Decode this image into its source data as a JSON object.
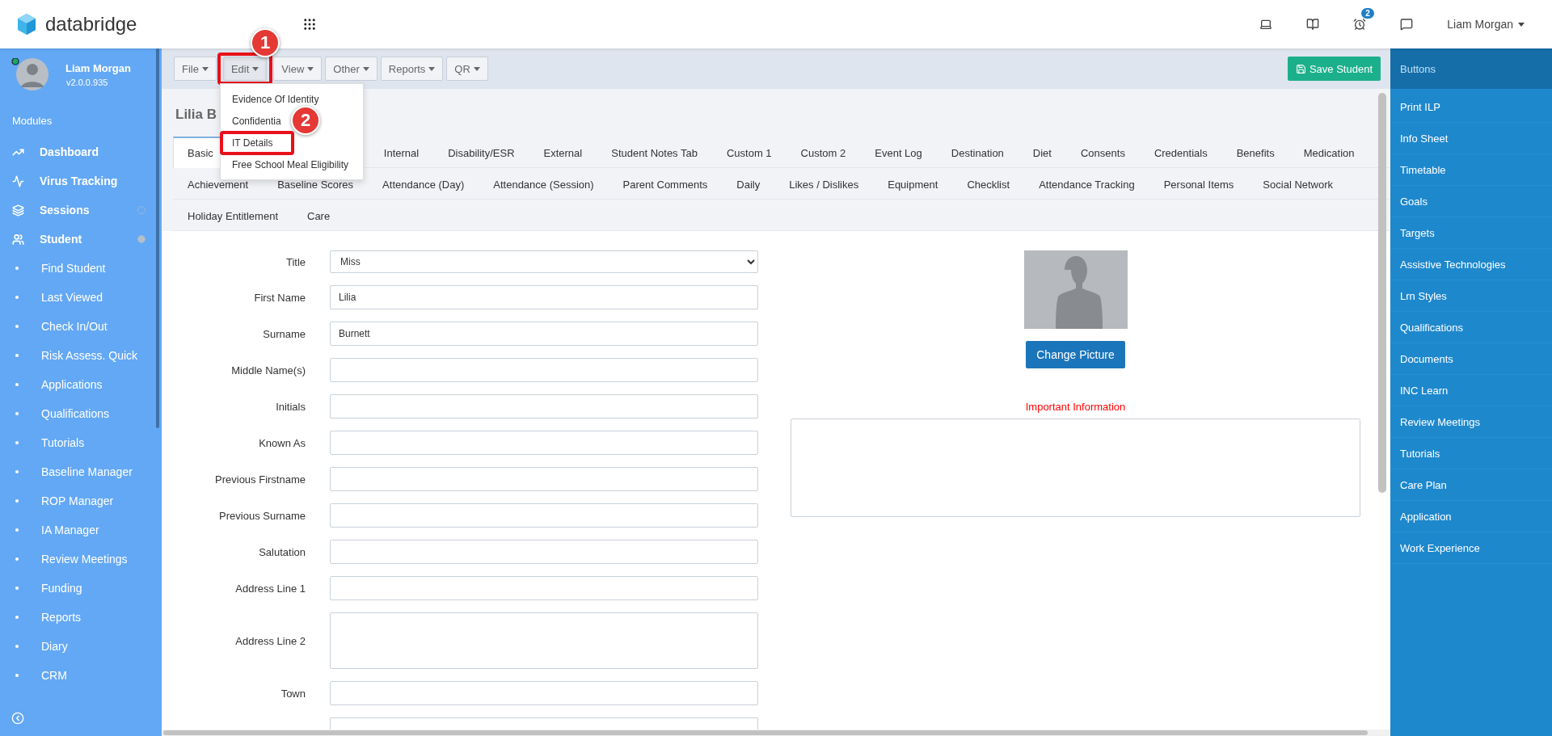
{
  "header": {
    "brand": "databridge",
    "badge_count": "2",
    "user": "Liam Morgan"
  },
  "sidebar": {
    "user_name": "Liam Morgan",
    "version": "v2.0.0.935",
    "section": "Modules",
    "modules": [
      {
        "label": "Dashboard",
        "kind": "link"
      },
      {
        "label": "Virus Tracking",
        "kind": "link"
      },
      {
        "label": "Sessions",
        "kind": "group",
        "expanded": false
      },
      {
        "label": "Student",
        "kind": "group",
        "expanded": true,
        "children": [
          "Find Student",
          "Last Viewed",
          "Check In/Out",
          "Risk Assess. Quick",
          "Applications",
          "Qualifications",
          "Tutorials",
          "Baseline Manager",
          "ROP Manager",
          "IA Manager",
          "Review Meetings",
          "Funding",
          "Reports",
          "Diary",
          "CRM"
        ]
      }
    ]
  },
  "toolbar": {
    "menus": [
      {
        "label": "File",
        "open": false,
        "annotated": false
      },
      {
        "label": "Edit",
        "open": true,
        "annotated": true
      },
      {
        "label": "View",
        "open": false,
        "annotated": false
      },
      {
        "label": "Other",
        "open": false,
        "annotated": false
      },
      {
        "label": "Reports",
        "open": false,
        "annotated": false
      },
      {
        "label": "QR",
        "open": false,
        "annotated": false
      }
    ],
    "save_button": "Save Student"
  },
  "dropdown": [
    {
      "label": "Evidence Of Identity",
      "annotated": false
    },
    {
      "label": "Confidentia",
      "annotated": false
    },
    {
      "label": "IT Details",
      "annotated": true
    },
    {
      "label": "Free School Meal Eligibility",
      "annotated": false
    }
  ],
  "student_title": "Lilia B",
  "tab_rows": [
    [
      {
        "label": "Basic",
        "selected": true
      },
      {
        "label": "Internal",
        "selected": false
      },
      {
        "label": "Disability/ESR",
        "selected": false
      },
      {
        "label": "External",
        "selected": false
      },
      {
        "label": "Student Notes Tab",
        "selected": false
      },
      {
        "label": "Custom 1",
        "selected": false
      },
      {
        "label": "Custom 2",
        "selected": false
      },
      {
        "label": "Event Log",
        "selected": false
      },
      {
        "label": "Destination",
        "selected": false
      },
      {
        "label": "Diet",
        "selected": false
      },
      {
        "label": "Consents",
        "selected": false
      },
      {
        "label": "Credentials",
        "selected": false
      },
      {
        "label": "Benefits",
        "selected": false
      },
      {
        "label": "Medication",
        "selected": false
      }
    ],
    [
      {
        "label": "Achievement",
        "selected": false
      },
      {
        "label": "Baseline Scores",
        "selected": false
      },
      {
        "label": "Attendance (Day)",
        "selected": false
      },
      {
        "label": "Attendance (Session)",
        "selected": false
      },
      {
        "label": "Parent Comments",
        "selected": false
      },
      {
        "label": "Daily",
        "selected": false
      },
      {
        "label": "Likes / Dislikes",
        "selected": false
      },
      {
        "label": "Equipment",
        "selected": false
      },
      {
        "label": "Checklist",
        "selected": false
      },
      {
        "label": "Attendance Tracking",
        "selected": false
      },
      {
        "label": "Personal Items",
        "selected": false
      },
      {
        "label": "Social Network",
        "selected": false
      }
    ],
    [
      {
        "label": "Holiday Entitlement",
        "selected": false
      },
      {
        "label": "Care",
        "selected": false
      }
    ]
  ],
  "fields": [
    {
      "label": "Title",
      "kind": "select",
      "value": "Miss"
    },
    {
      "label": "First Name",
      "kind": "text",
      "value": "Lilia"
    },
    {
      "label": "Surname",
      "kind": "text",
      "value": "Burnett"
    },
    {
      "label": "Middle Name(s)",
      "kind": "text"
    },
    {
      "label": "Initials",
      "kind": "text"
    },
    {
      "label": "Known As",
      "kind": "text"
    },
    {
      "label": "Previous Firstname",
      "kind": "text"
    },
    {
      "label": "Previous Surname",
      "kind": "text"
    },
    {
      "label": "Salutation",
      "kind": "text"
    },
    {
      "label": "Address Line 1",
      "kind": "text"
    },
    {
      "label": "Address Line 2",
      "kind": "textarea"
    },
    {
      "label": "Town",
      "kind": "text"
    },
    {
      "kind": "text"
    }
  ],
  "photo": {
    "button": "Change Picture",
    "info_label": "Important Information"
  },
  "buttons_panel": {
    "title": "Buttons",
    "items": [
      "Print ILP",
      "Info Sheet",
      "Timetable",
      "Goals",
      "Targets",
      "Assistive Technologies",
      "Lrn Styles",
      "Qualifications",
      "Documents",
      "INC Learn",
      "Review Meetings",
      "Tutorials",
      "Care Plan",
      "Application",
      "Work Experience"
    ]
  },
  "annotations": [
    {
      "label": "1"
    },
    {
      "label": "2"
    }
  ]
}
